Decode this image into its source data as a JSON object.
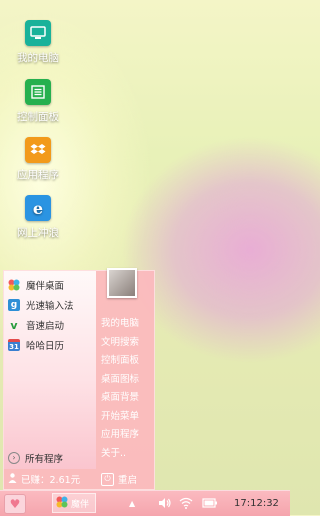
{
  "desktop": {
    "icons": [
      {
        "label": "我的电脑",
        "icon": "my-computer-icon",
        "color": "#19b29a"
      },
      {
        "label": "控制面板",
        "icon": "control-panel-icon",
        "color": "#26b04e"
      },
      {
        "label": "应用程序",
        "icon": "dropbox-icon",
        "color": "#f29a1b"
      },
      {
        "label": "网上冲浪",
        "icon": "ie-browser-icon",
        "color": "#2b94e2"
      }
    ]
  },
  "start_menu": {
    "pinned": [
      {
        "label": "魔伴桌面",
        "icon": "pinwheel-icon"
      },
      {
        "label": "光速输入法",
        "icon": "input-method-icon"
      },
      {
        "label": "音速启动",
        "icon": "v-launcher-icon"
      },
      {
        "label": "哈哈日历",
        "icon": "calendar-icon"
      }
    ],
    "all_programs": "所有程序",
    "right_links": [
      "我的电脑",
      "文明搜索",
      "控制面板",
      "桌面图标",
      "桌面背景",
      "开始菜单",
      "应用程序",
      "关于.."
    ],
    "user_status": "已赚：2.61元",
    "restart": "重启"
  },
  "taskbar": {
    "task_label": "魔伴",
    "clock": "17:12:32"
  },
  "colors": {
    "menu_bg": "#fdb6be",
    "taskbar_bg": "#f7aab2"
  }
}
